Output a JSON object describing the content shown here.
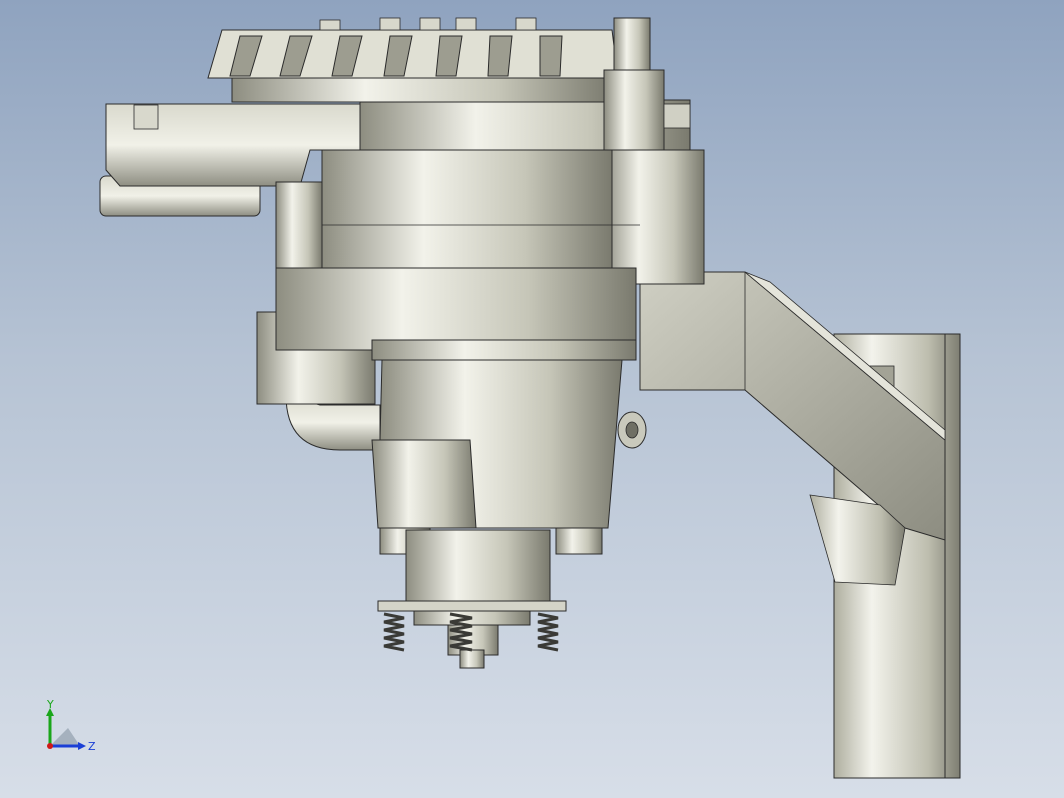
{
  "viewport": {
    "background_top": "#8fa3bf",
    "background_bottom": "#d7dee8",
    "model_name": ""
  },
  "triad": {
    "y_label": "Y",
    "z_label": "Z",
    "y_color": "#1aa61a",
    "z_color": "#1a3fd6",
    "x_color": "#d01818"
  },
  "model": {
    "metal_light": "#e7e7dc",
    "metal_mid": "#b9b9aa",
    "metal_dark": "#6f6f64",
    "spring_color": "#3a3a36"
  }
}
